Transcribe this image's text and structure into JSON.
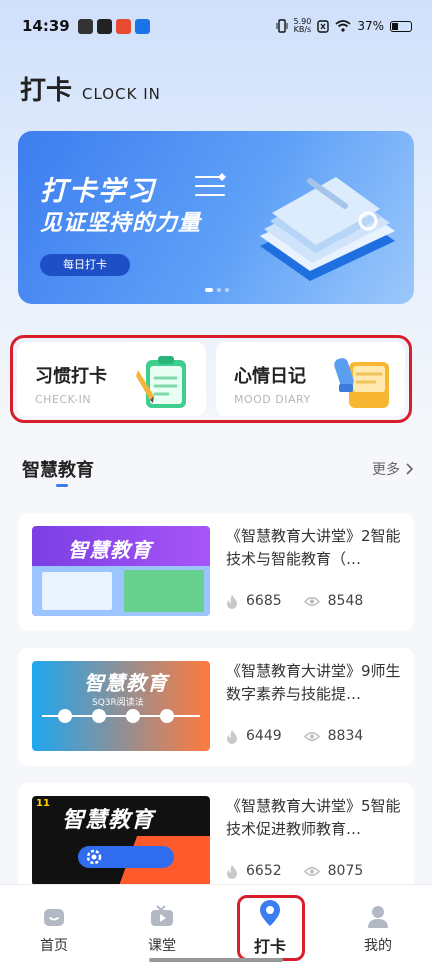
{
  "status_bar": {
    "time": "14:39",
    "net_speed_value": "5.90",
    "net_speed_unit": "KB/s",
    "battery": "37%"
  },
  "header": {
    "title": "打卡",
    "subtitle": "CLOCK IN"
  },
  "banner": {
    "line1": "打卡学习",
    "line2": "见证坚持的力量",
    "button": "每日打卡",
    "page_count": 3,
    "active_page": 0
  },
  "cards": [
    {
      "title": "习惯打卡",
      "subtitle": "CHECK-IN",
      "icon": "clipboard-pencil-icon"
    },
    {
      "title": "心情日记",
      "subtitle": "MOOD DIARY",
      "icon": "diary-book-icon"
    }
  ],
  "section": {
    "title": "智慧教育",
    "more": "更多"
  },
  "items": [
    {
      "title": "《智慧教育大讲堂》2智能技术与智能教育（…",
      "thumb_text": "智慧教育",
      "likes": "6685",
      "views": "8548"
    },
    {
      "title": "《智慧教育大讲堂》9师生数字素养与技能提…",
      "thumb_text": "智慧教育",
      "thumb_sub": "SQ3R阅读法",
      "likes": "6449",
      "views": "8834"
    },
    {
      "title": "《智慧教育大讲堂》5智能技术促进教师教育…",
      "thumb_text": "智慧教育",
      "thumb_badge": "11",
      "likes": "6652",
      "views": "8075"
    }
  ],
  "tabs": [
    {
      "label": "首页",
      "icon": "home-icon"
    },
    {
      "label": "课堂",
      "icon": "tv-icon"
    },
    {
      "label": "打卡",
      "icon": "location-pin-icon",
      "active": true
    },
    {
      "label": "我的",
      "icon": "person-icon"
    }
  ],
  "colors": {
    "accent": "#3b7cf0",
    "highlight_outline": "#d81e2a"
  }
}
